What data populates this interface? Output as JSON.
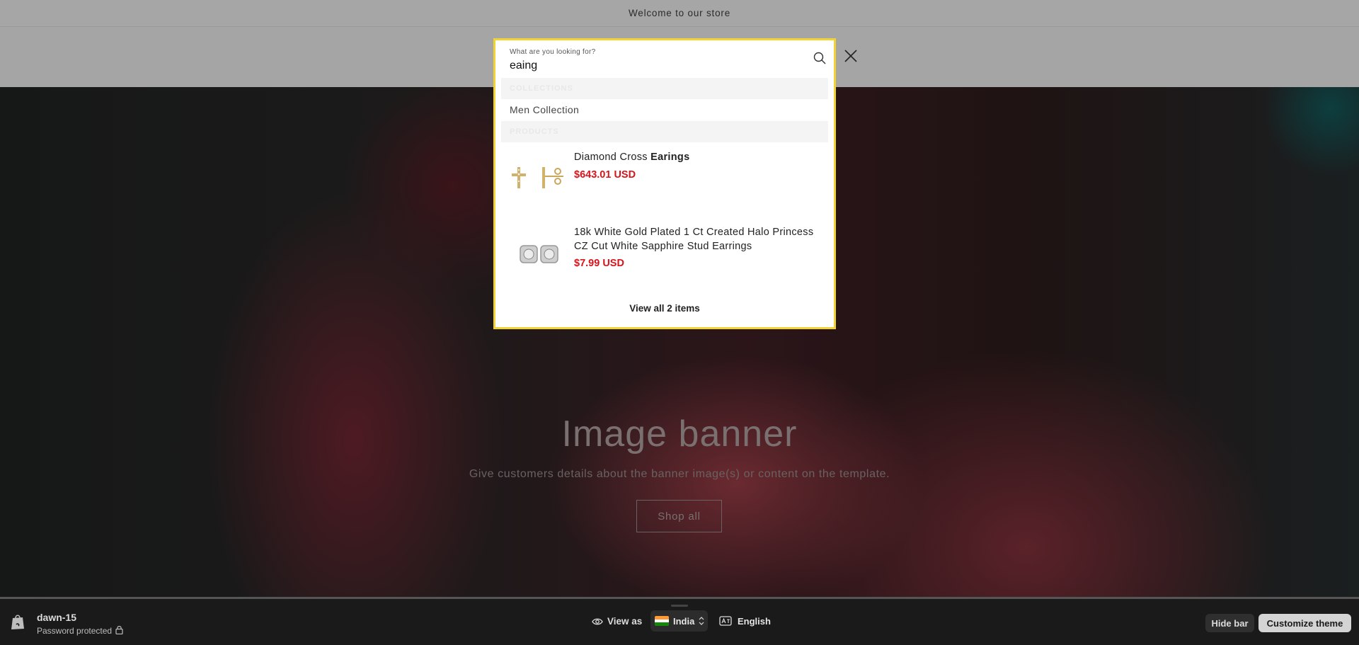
{
  "announcement": {
    "text": "Welcome to our store"
  },
  "banner": {
    "title": "Image banner",
    "subtitle": "Give customers details about the banner image(s) or content on the template.",
    "button_label": "Shop all"
  },
  "search": {
    "label": "What are you looking for?",
    "value": "eaing",
    "sections": {
      "collections_header": "COLLECTIONS",
      "products_header": "PRODUCTS"
    },
    "collections": [
      {
        "label": "Men Collection"
      }
    ],
    "products": [
      {
        "name_plain": "Diamond Cross ",
        "name_highlight": "Earings",
        "price": "$643.01 USD"
      },
      {
        "name_plain": "18k White Gold Plated 1 Ct Created Halo Princess CZ Cut White Sapphire Stud Earrings",
        "name_highlight": "",
        "price": "$7.99 USD"
      }
    ],
    "view_all": "View all 2 items"
  },
  "preview_bar": {
    "store_name": "dawn-15",
    "status": "Password protected",
    "view_as": "View as",
    "country": "India",
    "language": "English",
    "hide_bar": "Hide bar",
    "customize": "Customize theme"
  },
  "colors": {
    "modal_border": "#f2d334",
    "price": "#d7141b"
  }
}
